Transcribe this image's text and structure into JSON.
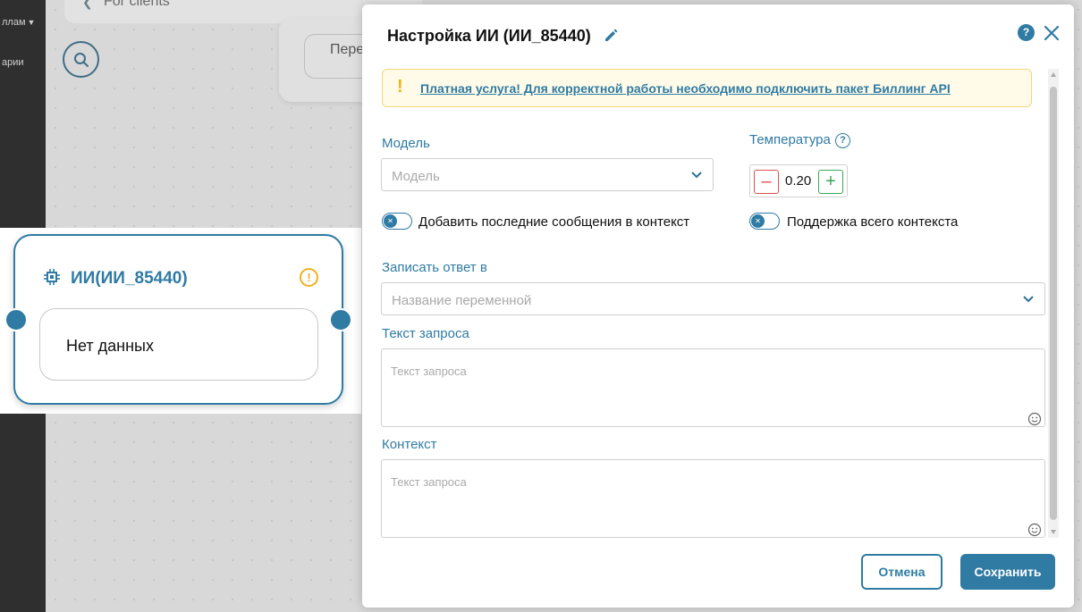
{
  "sidebar": {
    "item1_label": "ллам",
    "item2_label": "арии"
  },
  "canvas": {
    "top_title": "For clients",
    "bg_node_text": "Пере"
  },
  "node": {
    "title": "ИИ(ИИ_85440)",
    "body_text": "Нет данных"
  },
  "modal": {
    "title": "Настройка ИИ (ИИ_85440)",
    "help_label": "?",
    "banner": {
      "icon_text": "!",
      "text": "Платная услуга! Для корректной работы необходимо подключить пакет Биллинг API"
    },
    "model": {
      "label": "Модель",
      "placeholder": "Модель"
    },
    "temperature": {
      "label": "Температура",
      "help": "?",
      "value": "0.20",
      "minus": "–",
      "plus": "+"
    },
    "toggle_add_messages": {
      "label": "Добавить последние сообщения в контекст",
      "state": "off"
    },
    "toggle_full_context": {
      "label": "Поддержка всего контекста",
      "state": "off"
    },
    "save_to": {
      "label": "Записать ответ в",
      "placeholder": "Название переменной"
    },
    "request_text": {
      "label": "Текст запроса",
      "placeholder": "Текст запроса"
    },
    "context": {
      "label": "Контекст",
      "placeholder": "Текст запроса"
    },
    "cancel_label": "Отмена",
    "save_label": "Сохранить"
  },
  "colors": {
    "accent": "#2f7ba4",
    "warning": "#f2b01e",
    "danger": "#d9534f",
    "success": "#3aa655"
  }
}
